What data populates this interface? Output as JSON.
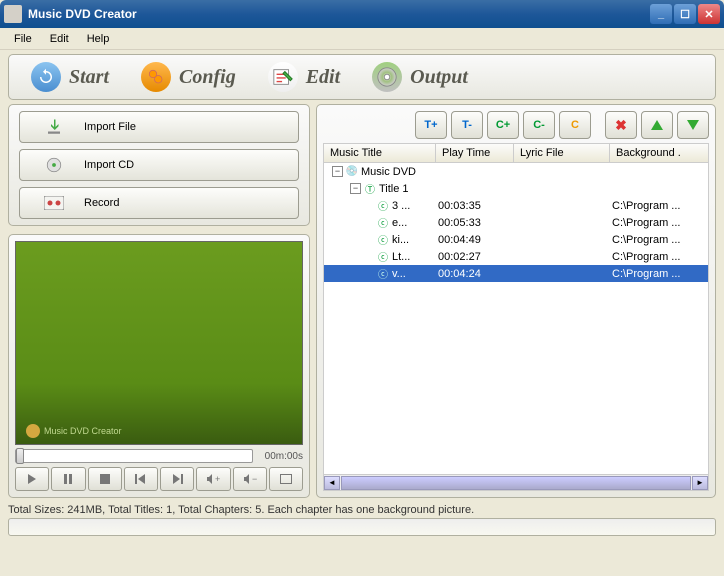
{
  "window": {
    "title": "Music DVD Creator"
  },
  "menubar": {
    "file": "File",
    "edit": "Edit",
    "help": "Help"
  },
  "toolbar": {
    "start": "Start",
    "config": "Config",
    "edit": "Edit",
    "output": "Output"
  },
  "import": {
    "file": "Import File",
    "cd": "Import CD",
    "record": "Record"
  },
  "player": {
    "time": "00m:00s",
    "logo_text": "Music DVD Creator"
  },
  "list": {
    "columns": {
      "title": "Music Title",
      "playtime": "Play Time",
      "lyric": "Lyric File",
      "bg": "Background ."
    },
    "root": "Music DVD",
    "title1": "Title 1",
    "tracks": [
      {
        "name": "3 ...",
        "time": "00:03:35",
        "lyric": "",
        "bg": "C:\\Program ..."
      },
      {
        "name": "e...",
        "time": "00:05:33",
        "lyric": "",
        "bg": "C:\\Program ..."
      },
      {
        "name": "ki...",
        "time": "00:04:49",
        "lyric": "",
        "bg": "C:\\Program ..."
      },
      {
        "name": "Lt...",
        "time": "00:02:27",
        "lyric": "",
        "bg": "C:\\Program ..."
      },
      {
        "name": "v...",
        "time": "00:04:24",
        "lyric": "",
        "bg": "C:\\Program ..."
      }
    ]
  },
  "tooltips": {
    "t_add": "T+",
    "t_del": "T-",
    "c_add": "C+",
    "c_del": "C-",
    "c_edit": "C"
  },
  "status": "Total Sizes: 241MB, Total Titles: 1, Total Chapters: 5. Each chapter has one background picture."
}
